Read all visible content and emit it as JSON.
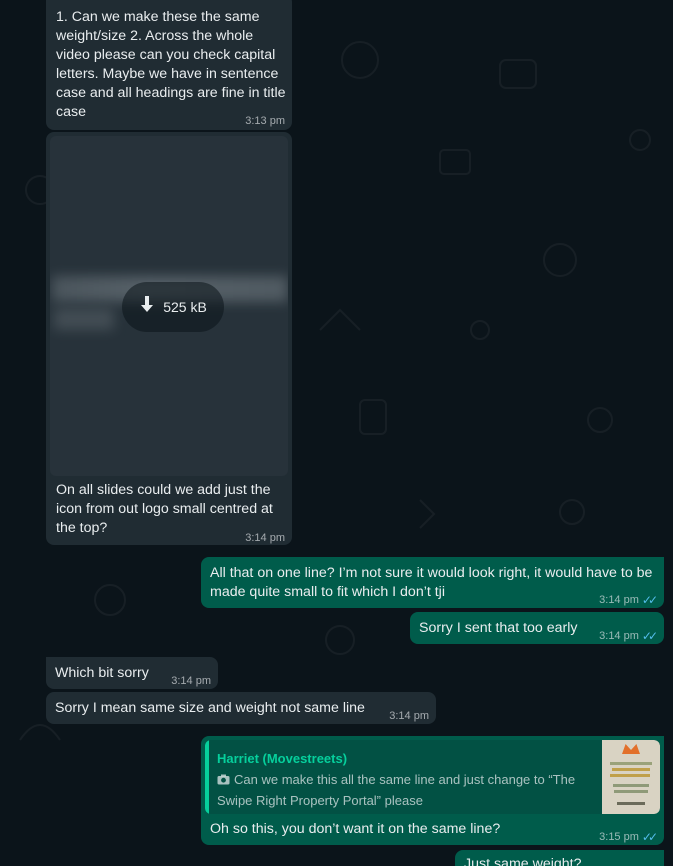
{
  "messages": [
    {
      "id": "m1",
      "direction": "incoming",
      "text": "1. Can we make these the same weight/size 2. Across the whole video please can you check capital letters. Maybe we have in sentence case and all headings are fine in title case",
      "time": "3:13 pm"
    },
    {
      "id": "m2",
      "direction": "incoming",
      "attachment": {
        "type": "image",
        "size": "525 kB",
        "icon": "download-icon"
      },
      "caption": "On all slides could we add just the icon from out logo small centred at the top?",
      "time": "3:14 pm"
    },
    {
      "id": "m3",
      "direction": "outgoing",
      "text": "All that on one line? I’m not sure it would look right, it would have to be made quite small to fit which I don’t tji",
      "time": "3:14 pm",
      "status": "read"
    },
    {
      "id": "m4",
      "direction": "outgoing",
      "text": "Sorry I sent that too early",
      "time": "3:14 pm",
      "status": "read"
    },
    {
      "id": "m5",
      "direction": "incoming",
      "text": "Which bit sorry",
      "time": "3:14 pm"
    },
    {
      "id": "m6",
      "direction": "incoming",
      "text": "Sorry I mean same size and weight not same line",
      "time": "3:14 pm"
    },
    {
      "id": "m7",
      "direction": "outgoing",
      "reply_to": {
        "author": "Harriet (Movestreets)",
        "icon": "camera-icon",
        "text": "Can we make this all the same line and just change to “The Swipe Right Property Portal” please"
      },
      "text": "Oh so this, you don’t want it on the same line?",
      "time": "3:15 pm",
      "status": "read"
    },
    {
      "id": "m8",
      "direction": "outgoing",
      "text": "Just same weight?",
      "partial": true
    }
  ],
  "colors": {
    "background": "#0b141a",
    "incoming": "#202c33",
    "outgoing": "#005c4b",
    "read_ticks": "#53bdeb",
    "quote_accent": "#06cf9c"
  }
}
